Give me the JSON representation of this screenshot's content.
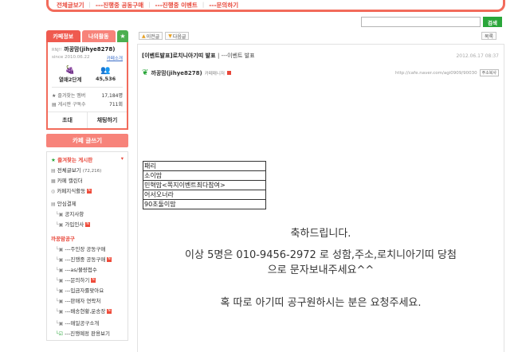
{
  "topnav": {
    "items": [
      "전체글보기",
      "---진행중 공동구매",
      "---진행중 이벤트",
      "---문의하기"
    ]
  },
  "search": {
    "button_label": "검색",
    "value": ""
  },
  "sidebar": {
    "tabs": {
      "cafe_info": "카페정보",
      "my_activity": "나의활동",
      "star": "★"
    },
    "profile": {
      "tag": "RNJ!!",
      "name": "까꿍맘(jihye8278)",
      "since": "since 2010.06.22",
      "cafe_intro": "카페소개"
    },
    "stats": {
      "level": "열매2단계",
      "members": "45,536"
    },
    "info": [
      {
        "label": "즐겨찾는 멤버",
        "value": "17,184명"
      },
      {
        "label": "게시판 구독수",
        "value": "711회"
      }
    ],
    "buttons": {
      "invite": "초대",
      "chat": "채팅하기"
    },
    "write_button": "카페 글쓰기",
    "favorites_head": "즐겨찾는 게시판",
    "menu": [
      {
        "label": "전체글보기",
        "count": "(72,216)"
      },
      {
        "label": "카페 캘린더",
        "count": ""
      },
      {
        "label": "카페지식활동",
        "count": ""
      }
    ],
    "safe_head": "안심결제",
    "safe_items": [
      "공지사항",
      "가입인사"
    ],
    "section_head": "까꿍맘공구",
    "gongu_items": [
      "---주인장 공동구매",
      "---진행중 공동구매",
      "---as/불량접수",
      "---문의하기",
      "---입금자률맞아요",
      "---판매자 연락처",
      "---배송현황,운송장",
      "---매일공구소개",
      "---진행예정 판용보기"
    ]
  },
  "nav": {
    "prev": "이전글",
    "next": "다음글",
    "list": "목록"
  },
  "article": {
    "title": "[이벤트발표]로치니아기띠 발표",
    "category": "---이벤트 발표",
    "date": "2012.06.17 08:37",
    "author": "까꿍맘(jihye8278)",
    "role": "카페매니저",
    "url": "http://cafe.naver.com/agi0909/90030",
    "copy": "주소복사",
    "winners": [
      "패리",
      "소이맘",
      "민혁맘<쪽지이벤트최다참여>",
      "어서오너라",
      "90초둘이맘"
    ],
    "congrats": "축하드립니다.",
    "msg1": "이상 5명은  010-9456-2972 로 성함,주소,로치니아기띠 당첨",
    "msg2": "으로 문자보내주세요^^",
    "msg3": "혹 따로 아기띠 공구원하시는 분은 요청주세요."
  },
  "colors": {
    "accent": "#f26b5b",
    "green": "#2aa63a",
    "red": "#e8473a"
  }
}
